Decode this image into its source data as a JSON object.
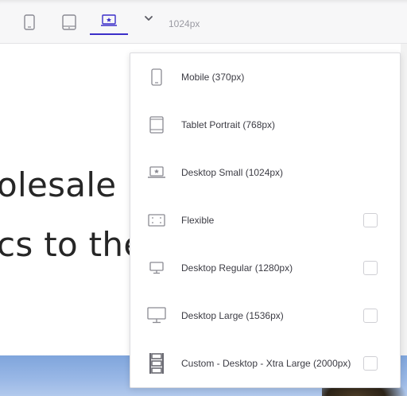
{
  "toolbar": {
    "zoom_label": "1024px",
    "accent_color": "#3b2fc9",
    "buttons": [
      {
        "icon": "mobile-icon"
      },
      {
        "icon": "tablet-icon"
      },
      {
        "icon": "desktop-small-icon",
        "active": true
      },
      {
        "icon": "chevron-down-icon"
      }
    ]
  },
  "canvas": {
    "heading_line_1": "olesale",
    "heading_line_2": "cs to the"
  },
  "dropdown": {
    "items": [
      {
        "label": "Mobile (370px)",
        "icon": "mobile-icon",
        "has_checkbox": false
      },
      {
        "label": "Tablet Portrait (768px)",
        "icon": "tablet-icon",
        "has_checkbox": false
      },
      {
        "label": "Desktop Small (1024px)",
        "icon": "desktop-small-icon",
        "has_checkbox": false
      },
      {
        "label": "Flexible",
        "icon": "flexible-icon",
        "has_checkbox": true,
        "checked": false
      },
      {
        "label": "Desktop Regular (1280px)",
        "icon": "desktop-regular-icon",
        "has_checkbox": true,
        "checked": false
      },
      {
        "label": "Desktop Large (1536px)",
        "icon": "desktop-large-icon",
        "has_checkbox": true,
        "checked": false
      },
      {
        "label": "Custom - Desktop - Xtra Large (2000px)",
        "icon": "custom-desktop-icon",
        "has_checkbox": true,
        "checked": false
      }
    ]
  }
}
